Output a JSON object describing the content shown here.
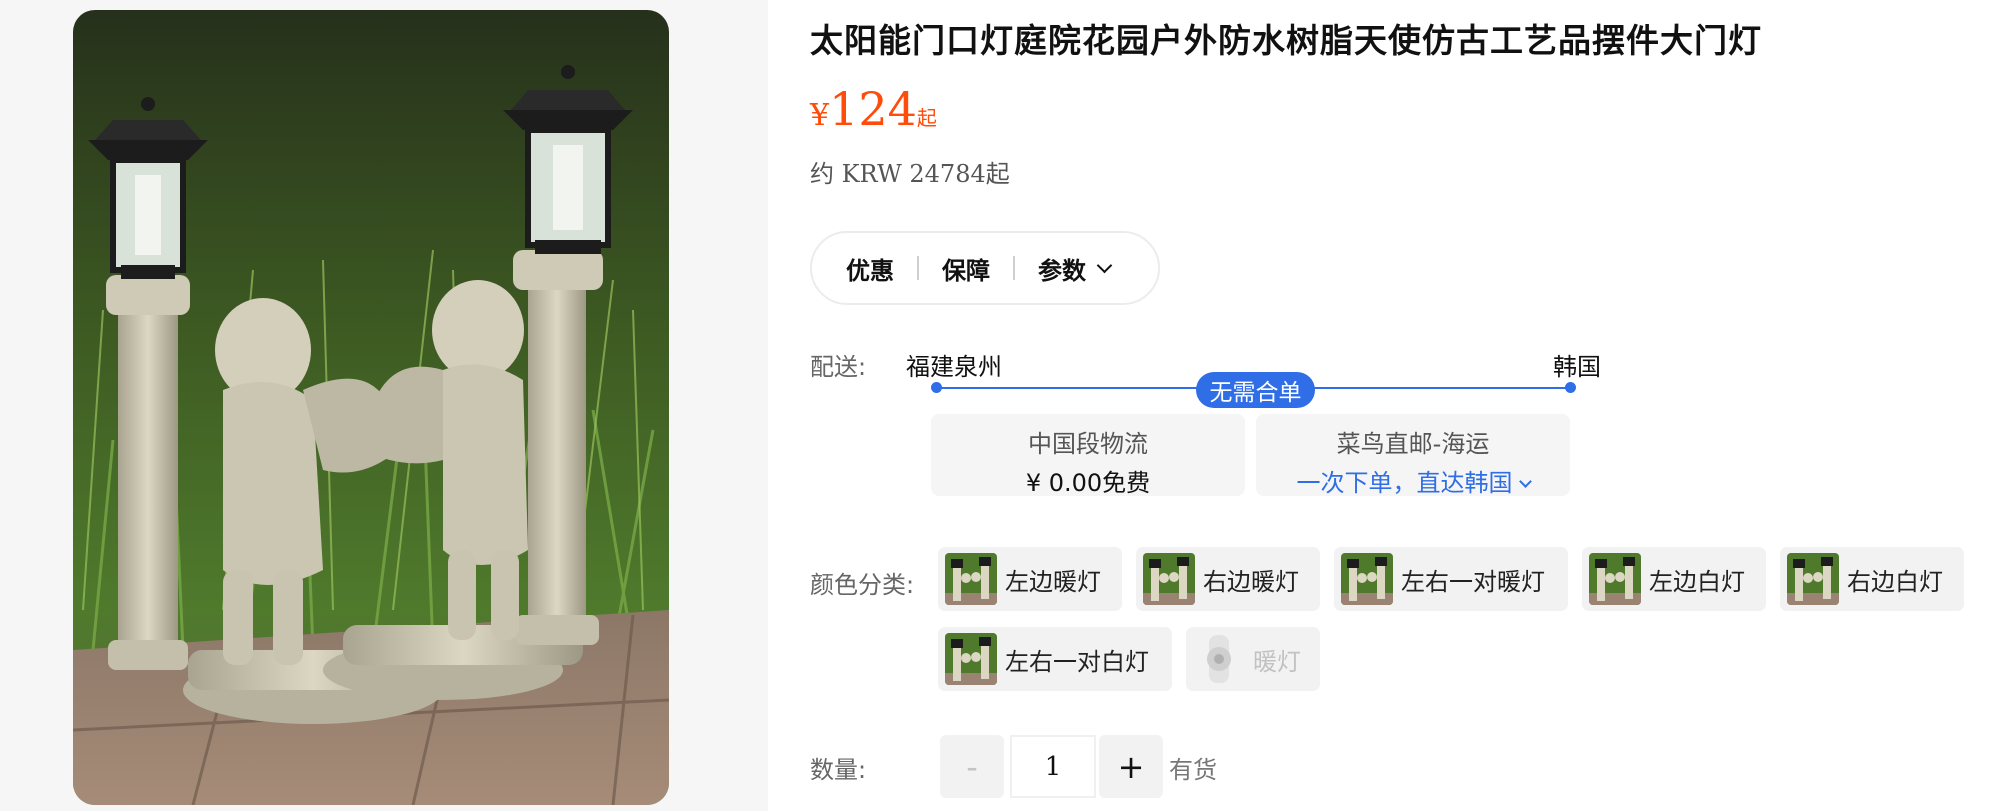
{
  "product": {
    "title": "太阳能门口灯庭院花园户外防水树脂天使仿古工艺品摆件大门灯",
    "price": {
      "currency": "¥",
      "amount": "124",
      "suffix": "起"
    },
    "approx_price": "约 KRW 24784起",
    "image_icon": "product-photo"
  },
  "tabs": [
    {
      "label": "优惠"
    },
    {
      "label": "保障"
    },
    {
      "label": "参数",
      "icon": "chevron-down-icon"
    }
  ],
  "delivery": {
    "label": "配送:",
    "from": "福建泉州",
    "to": "韩国",
    "badge": "无需合单",
    "segments": [
      {
        "title": "中国段物流",
        "detail": "¥ 0.00免费"
      },
      {
        "title": "菜鸟直邮-海运",
        "detail": "一次下单，直达韩国",
        "icon": "chevron-down-icon"
      }
    ]
  },
  "color_options": {
    "label": "颜色分类:",
    "items": [
      {
        "label": "左边暖灯",
        "enabled": true
      },
      {
        "label": "右边暖灯",
        "enabled": true
      },
      {
        "label": "左右一对暖灯",
        "enabled": true
      },
      {
        "label": "左边白灯",
        "enabled": true
      },
      {
        "label": "右边白灯",
        "enabled": true
      },
      {
        "label": "左右一对白灯",
        "enabled": true
      },
      {
        "label": "暖灯",
        "enabled": false
      }
    ]
  },
  "quantity": {
    "label": "数量:",
    "decrement": "-",
    "value": "1",
    "increment": "+",
    "stock": "有货"
  },
  "colors": {
    "price": "#ff4c0a",
    "accent_blue": "#2f6ee6",
    "option_bg": "#f2f2f2"
  }
}
